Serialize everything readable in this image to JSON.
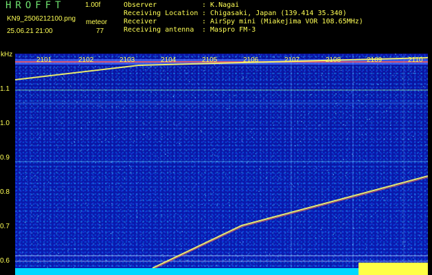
{
  "header": {
    "title": "HROFFT",
    "version": "1.00f",
    "filename": "KN9_2506212100.png",
    "meteor_label": "meteor",
    "meteor_count": "77",
    "datetime": "25.06.21 21:00",
    "fields": [
      {
        "label": "Observer",
        "value": ": K.Nagai"
      },
      {
        "label": "Receiving Location",
        "value": ": Chigasaki, Japan (139.414 35.340)"
      },
      {
        "label": "Receiver",
        "value": ": AirSpy mini (Miakejima VOR 108.65MHz)"
      },
      {
        "label": "Receiving antenna",
        "value": ": Maspro FM-3"
      }
    ]
  },
  "plot": {
    "unit_label": "kHz",
    "y_ticks": [
      "1.1",
      "1.0",
      "0.9",
      "0.8",
      "0.7",
      "0.6"
    ],
    "time_ticks": [
      "2101",
      "2102",
      "2103",
      "2104",
      "2105",
      "2106",
      "2107",
      "2108",
      "2109",
      "2110"
    ],
    "colors": {
      "background": "#0a16a8",
      "text": "#ffff55",
      "trace": "#ffff66",
      "signal": "#ff5555",
      "floor": "#00e0ff"
    }
  }
}
